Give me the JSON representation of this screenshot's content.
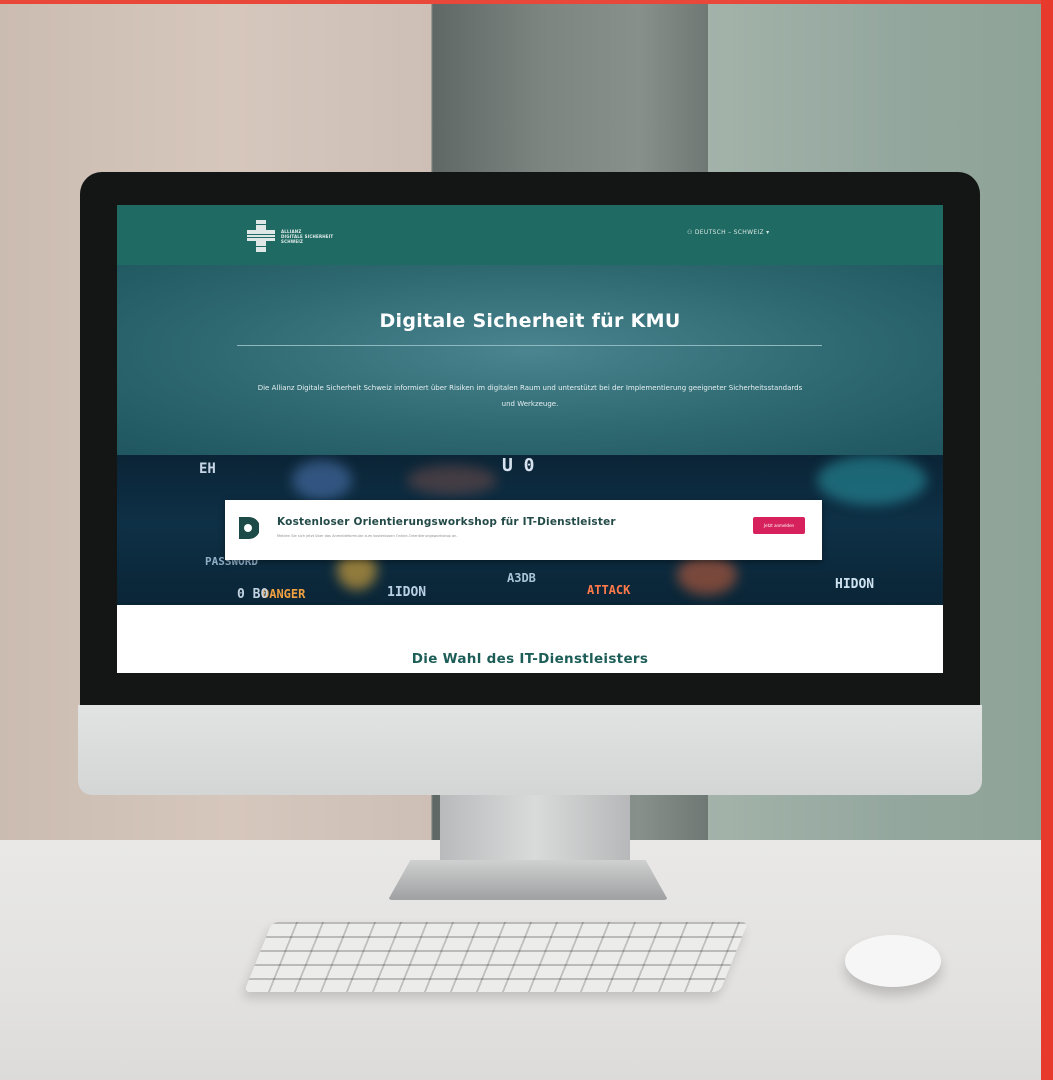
{
  "site": {
    "logo": {
      "line1": "ALLIANZ",
      "line2": "DIGITALE SICHERHEIT",
      "line3": "SCHWEIZ"
    },
    "language_selector": "DEUTSCH – SCHWEIZ ▾"
  },
  "hero": {
    "title": "Digitale Sicherheit für KMU",
    "text": "Die Allianz Digitale Sicherheit Schweiz informiert über Risiken im digitalen Raum und unterstützt bei der Implementierung geeigneter Sicherheitsstandards und Werkzeuge."
  },
  "banner": {
    "words": [
      "EH",
      "U 0",
      "PASSWORD",
      "1IDON",
      "DANGER",
      "ATTACK",
      "HIDON",
      "0 B0",
      "A3DB"
    ],
    "card": {
      "title": "Kostenloser Orientierungsworkshop für IT-Dienstleister",
      "subtitle": "Melden Sie sich jetzt über das Anmeldeformular zum kostenlosen Online-Orientierungsworkshop an.",
      "button": "Jetzt anmelden"
    }
  },
  "section": {
    "title": "Die Wahl des IT-Dienstleisters"
  },
  "colors": {
    "header": "#1f6b63",
    "hero": "#2e6870",
    "accent_button": "#d6215d",
    "frame_strip": "#e8392d"
  }
}
